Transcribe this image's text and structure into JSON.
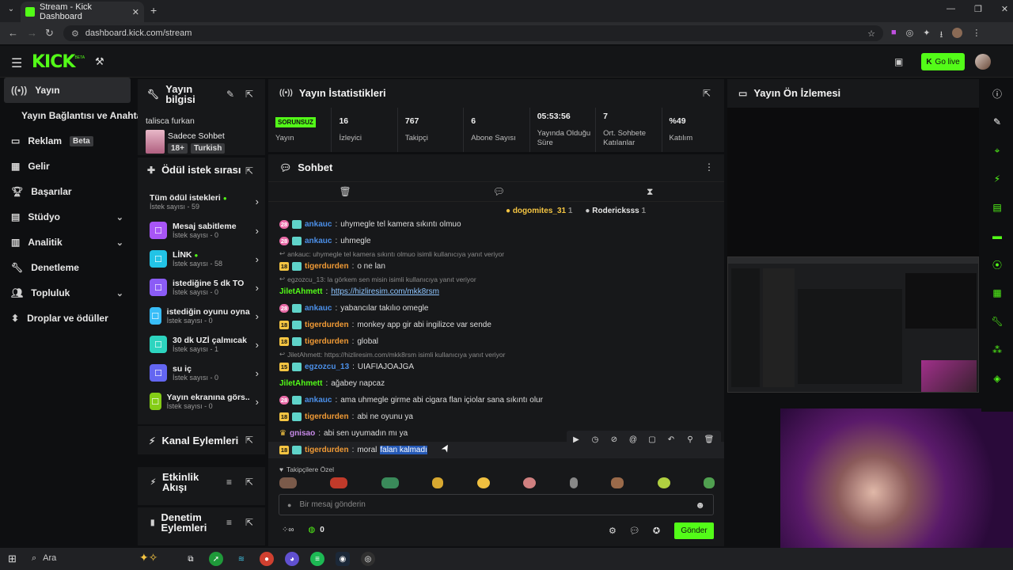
{
  "browser": {
    "tab_title": "Stream - Kick Dashboard",
    "url": "dashboard.kick.com/stream"
  },
  "header": {
    "logo": "KICK",
    "logo_sup": "BETA",
    "go_live": "Go live"
  },
  "nav": {
    "items": [
      {
        "label": "Yayın",
        "icon": "broadcast-icon"
      },
      {
        "label": "Yayın Bağlantısı ve Anahtarı"
      },
      {
        "label": "Reklam",
        "badge": "Beta"
      },
      {
        "label": "Gelir"
      },
      {
        "label": "Başarılar"
      },
      {
        "label": "Stüdyo"
      },
      {
        "label": "Analitik"
      },
      {
        "label": "Denetleme"
      },
      {
        "label": "Topluluk"
      },
      {
        "label": "Droplar ve ödüller"
      }
    ]
  },
  "stream_info": {
    "title": "Yayın bilgisi",
    "channel": "talisca furkan",
    "category": "Sadece Sohbet",
    "tag_age": "18+",
    "tag_lang": "Turkish"
  },
  "rewards": {
    "title": "Ödül istek sırası",
    "all_label": "Tüm ödül istekleri",
    "all_count": "İstek sayısı - 59",
    "items": [
      {
        "name": "Mesaj sabitleme",
        "count": "İstek sayısı - 0",
        "color": "#a855f7"
      },
      {
        "name": "LİNK",
        "count": "İstek sayısı - 58",
        "color": "#22c3e6"
      },
      {
        "name": "istediğine 5 dk TO",
        "count": "İstek sayısı - 0",
        "color": "#8b5cf6"
      },
      {
        "name": "istediğin oyunu oyna...",
        "count": "İstek sayısı - 0",
        "color": "#38bdf8"
      },
      {
        "name": "30 dk UZİ çalmıcak",
        "count": "İstek sayısı - 1",
        "color": "#2dd4bf"
      },
      {
        "name": "su iç",
        "count": "İstek sayısı - 0",
        "color": "#6366f1"
      },
      {
        "name": "Yayın ekranına görs...",
        "count": "İstek sayısı - 0",
        "color": "#84cc16"
      }
    ]
  },
  "channel_actions": {
    "title": "Kanal Eylemleri"
  },
  "activity": {
    "title": "Etkinlik Akışı"
  },
  "moderation": {
    "title": "Denetim Eylemleri"
  },
  "stats": {
    "title": "Yayın İstatistikleri",
    "status": "SORUNSUZ",
    "status_label": "Yayın",
    "items": [
      {
        "value": "16",
        "label": "İzleyici"
      },
      {
        "value": "767",
        "label": "Takipçi"
      },
      {
        "value": "6",
        "label": "Abone Sayısı"
      },
      {
        "value": "05:53:56",
        "label": "Yayında Olduğu Süre"
      },
      {
        "value": "7",
        "label": "Ort. Sohbete Katılanlar"
      },
      {
        "value": "%49",
        "label": "Katılım"
      }
    ]
  },
  "chat": {
    "title": "Sohbet",
    "top_gifters": [
      {
        "name": "dogomites_31",
        "count": "1"
      },
      {
        "name": "Rodericksss",
        "count": "1"
      }
    ],
    "messages": [
      {
        "type": "msg",
        "badge": "28",
        "user": "ankauc",
        "ucls": "u-bl",
        "text": "uhymegle tel kamera sıkıntı olmuo"
      },
      {
        "type": "msg",
        "badge": "28",
        "user": "ankauc",
        "ucls": "u-bl",
        "text": "uhmegle"
      },
      {
        "type": "reply",
        "text": "ankauc: uhymegle tel kamera sıkıntı olmuo isimli kullanıcıya yanıt veriyor"
      },
      {
        "type": "msg",
        "badge": "18",
        "user": "tigerdurden",
        "ucls": "u-or",
        "text": "o ne lan"
      },
      {
        "type": "reply",
        "text": "egzozcu_13: la görkem sen misin isimli kullanıcıya yanıt veriyor"
      },
      {
        "type": "msg",
        "badge": "",
        "user": "JiletAhmett",
        "ucls": "u-gr",
        "text": "",
        "link": "https://hizliresim.com/mkk8rsm"
      },
      {
        "type": "msg",
        "badge": "28",
        "user": "ankauc",
        "ucls": "u-bl",
        "text": "yabancılar takılıo omegle"
      },
      {
        "type": "msg",
        "badge": "18",
        "user": "tigerdurden",
        "ucls": "u-or",
        "text": "monkey app gir abi ingilizce var sende"
      },
      {
        "type": "msg",
        "badge": "18",
        "user": "tigerdurden",
        "ucls": "u-or",
        "text": "global"
      },
      {
        "type": "reply",
        "text": "JiletAhmett: https://hizliresim.com/mkk8rsm isimli kullanıcıya yanıt veriyor"
      },
      {
        "type": "msg",
        "badge": "15",
        "user": "egzozcu_13",
        "ucls": "u-bl",
        "text": "UIAFIAJOAJGA"
      },
      {
        "type": "msg",
        "badge": "",
        "user": "JiletAhmett",
        "ucls": "u-gr",
        "text": "ağabey napcaz"
      },
      {
        "type": "msg",
        "badge": "28",
        "user": "ankauc",
        "ucls": "u-bl",
        "text": "ama uhmegle girme abi cigara flan içiolar sana sıkıntı olur"
      },
      {
        "type": "msg",
        "badge": "18",
        "user": "tigerdurden",
        "ucls": "u-or",
        "text": "abi ne oyunu ya"
      },
      {
        "type": "msg",
        "badge": "crown",
        "user": "gnisao",
        "ucls": "u-pu",
        "text": "abi sen uyumadın mı ya"
      },
      {
        "type": "msg",
        "badge": "18",
        "user": "tigerdurden",
        "ucls": "u-or",
        "text": "moral ",
        "sel": "falan kalmadı"
      }
    ],
    "emote_section": "Takipçilere Özel",
    "placeholder": "Bir mesaj gönderin",
    "points": "0",
    "send": "Gönder"
  },
  "preview": {
    "title": "Yayın Ön İzlemesi"
  },
  "taskbar": {
    "search": "Ara"
  }
}
